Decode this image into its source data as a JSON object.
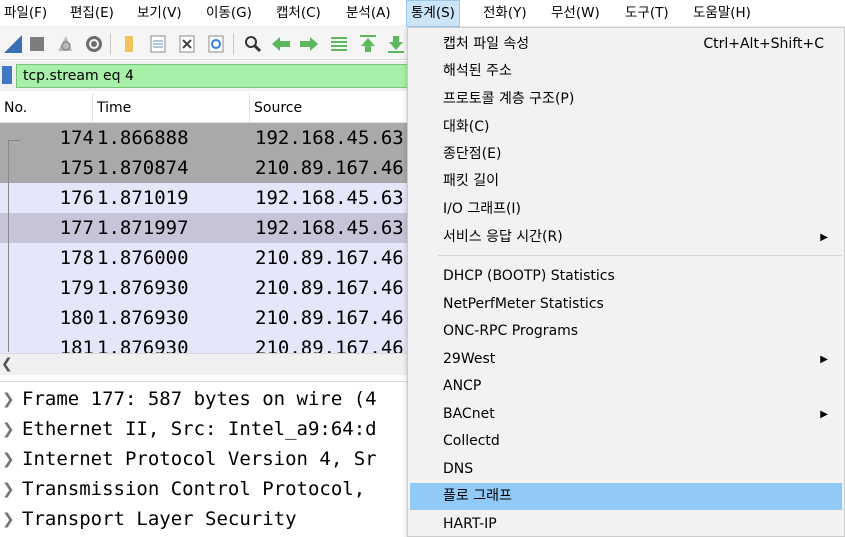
{
  "menubar": {
    "items": [
      {
        "label": "파일(F)"
      },
      {
        "label": "편집(E)"
      },
      {
        "label": "보기(V)"
      },
      {
        "label": "이동(G)"
      },
      {
        "label": "캡처(C)"
      },
      {
        "label": "분석(A)"
      },
      {
        "label": "통계(S)"
      },
      {
        "label": "전화(Y)"
      },
      {
        "label": "무선(W)"
      },
      {
        "label": "도구(T)"
      },
      {
        "label": "도움말(H)"
      }
    ]
  },
  "filter": {
    "value": "tcp.stream eq 4"
  },
  "packet_list": {
    "columns": [
      "No.",
      "Time",
      "Source"
    ],
    "rows": [
      {
        "no": "174",
        "time": "1.866888",
        "source": "192.168.45.63"
      },
      {
        "no": "175",
        "time": "1.870874",
        "source": "210.89.167.46"
      },
      {
        "no": "176",
        "time": "1.871019",
        "source": "192.168.45.63"
      },
      {
        "no": "177",
        "time": "1.871997",
        "source": "192.168.45.63"
      },
      {
        "no": "178",
        "time": "1.876000",
        "source": "210.89.167.46"
      },
      {
        "no": "179",
        "time": "1.876930",
        "source": "210.89.167.46"
      },
      {
        "no": "180",
        "time": "1.876930",
        "source": "210.89.167.46"
      },
      {
        "no": "181",
        "time": "1.876930",
        "source": "210.89.167.46"
      }
    ]
  },
  "details": {
    "rows": [
      {
        "text": "Frame 177: 587 bytes on wire (4"
      },
      {
        "text": "Ethernet II, Src: Intel_a9:64:d"
      },
      {
        "text": "Internet Protocol Version 4, Sr"
      },
      {
        "text": "Transmission Control Protocol,"
      },
      {
        "text": "Transport Layer Security"
      }
    ]
  },
  "statistics_menu": {
    "items": [
      {
        "label": "캡처 파일 속성",
        "shortcut": "Ctrl+Alt+Shift+C"
      },
      {
        "label": "해석된 주소"
      },
      {
        "label": "프로토콜 계층 구조(P)"
      },
      {
        "label": "대화(C)"
      },
      {
        "label": "종단점(E)"
      },
      {
        "label": "패킷 길이"
      },
      {
        "label": "I/O 그래프(I)"
      },
      {
        "label": "서비스 응답 시간(R)"
      },
      {
        "label": "DHCP (BOOTP) Statistics"
      },
      {
        "label": "NetPerfMeter Statistics"
      },
      {
        "label": "ONC-RPC Programs"
      },
      {
        "label": "29West"
      },
      {
        "label": "ANCP"
      },
      {
        "label": "BACnet"
      },
      {
        "label": "Collectd"
      },
      {
        "label": "DNS"
      },
      {
        "label": "플로 그래프"
      },
      {
        "label": "HART-IP"
      }
    ]
  }
}
